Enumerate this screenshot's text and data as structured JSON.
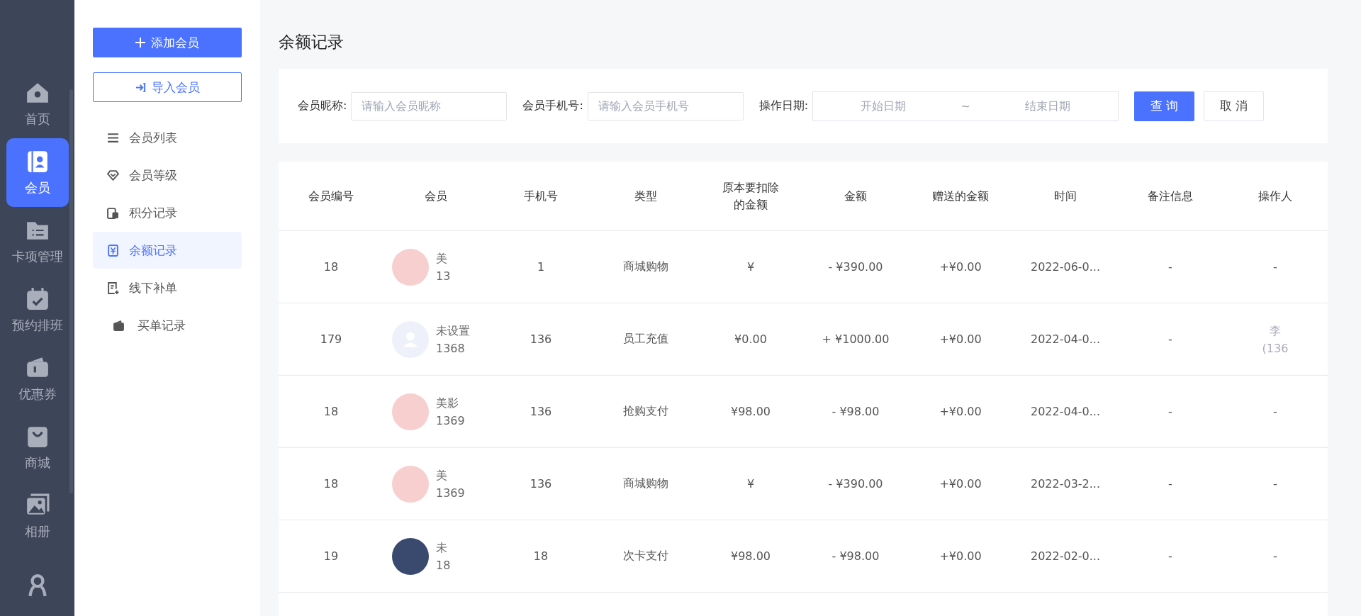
{
  "rail": {
    "items": [
      {
        "label": "首页",
        "selected": false
      },
      {
        "label": "会员",
        "selected": true
      },
      {
        "label": "卡项管理",
        "selected": false
      },
      {
        "label": "预约排班",
        "selected": false
      },
      {
        "label": "优惠券",
        "selected": false
      },
      {
        "label": "商城",
        "selected": false
      },
      {
        "label": "相册",
        "selected": false
      },
      {
        "selected": false
      }
    ]
  },
  "sidebar": {
    "add_button": "添加会员",
    "import_button": "导入会员",
    "items": [
      {
        "label": "会员列表",
        "selected": false
      },
      {
        "label": "会员等级",
        "selected": false
      },
      {
        "label": "积分记录",
        "selected": false
      },
      {
        "label": "余额记录",
        "selected": true
      },
      {
        "label": "线下补单",
        "selected": false
      },
      {
        "label": "买单记录",
        "selected": false
      }
    ]
  },
  "page_title": "余额记录",
  "filters": {
    "nickname_label": "会员昵称:",
    "nickname_placeholder": "请输入会员昵称",
    "phone_label": "会员手机号:",
    "phone_placeholder": "请输入会员手机号",
    "date_label": "操作日期:",
    "start_placeholder": "开始日期",
    "separator": "~",
    "end_placeholder": "结束日期",
    "query_button": "查 询",
    "cancel_button": "取 消"
  },
  "table": {
    "columns": [
      "会员编号",
      "会员",
      "手机号",
      "类型",
      "原本要扣除的金额",
      "金额",
      "赠送的金额",
      "时间",
      "备注信息",
      "操作人"
    ],
    "rows": [
      {
        "id": "18",
        "kind": "cartoon",
        "name": "美",
        "member_phone": "13",
        "phone": "1",
        "type": "商城购物",
        "original": "¥",
        "amount": "- ¥390.00",
        "gift": "+¥0.00",
        "time": "2022-06-0...",
        "note": "-",
        "operator": "-"
      },
      {
        "id": "179",
        "kind": "default",
        "name": "未设置",
        "member_phone": "1368",
        "phone": "136",
        "type": "员工充值",
        "original": "¥0.00",
        "amount": "+ ¥1000.00",
        "gift": "+¥0.00",
        "time": "2022-04-0...",
        "note": "-",
        "operator": "李",
        "operator_phone": "(136"
      },
      {
        "id": "18",
        "kind": "cartoon",
        "name": "美影",
        "member_phone": "1369",
        "phone": "136",
        "type": "抢购支付",
        "original": "¥98.00",
        "amount": "- ¥98.00",
        "gift": "+¥0.00",
        "time": "2022-04-0...",
        "note": "-",
        "operator": "-"
      },
      {
        "id": "18",
        "kind": "cartoon",
        "name": "美",
        "member_phone": "1369",
        "phone": "136",
        "type": "商城购物",
        "original": "¥",
        "amount": "- ¥390.00",
        "gift": "+¥0.00",
        "time": "2022-03-2...",
        "note": "-",
        "operator": "-"
      },
      {
        "id": "19",
        "kind": "photo",
        "name": "未",
        "member_phone": "18",
        "phone": "18",
        "type": "次卡支付",
        "original": "¥98.00",
        "amount": "- ¥98.00",
        "gift": "+¥0.00",
        "time": "2022-02-0...",
        "note": "-",
        "operator": "-"
      }
    ]
  }
}
